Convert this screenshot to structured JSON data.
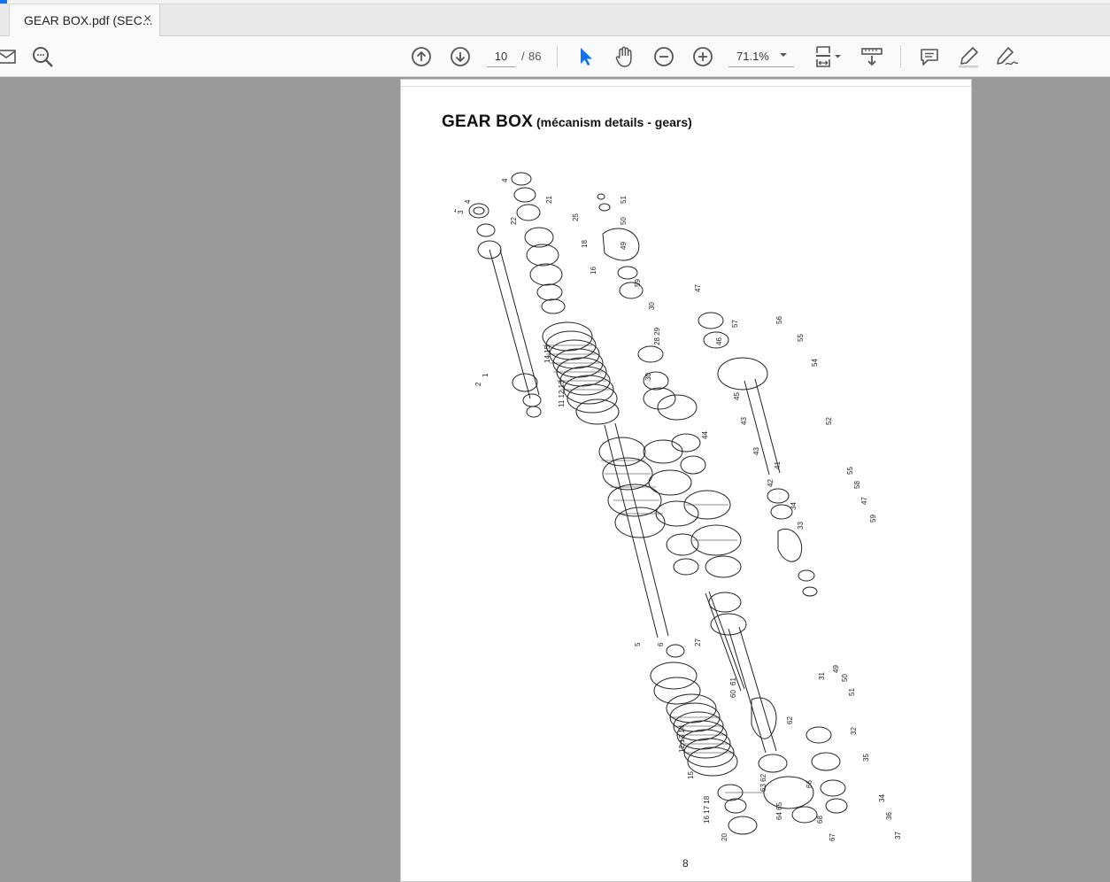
{
  "tab": {
    "title": "GEAR BOX.pdf (SEC...",
    "close_glyph": "×"
  },
  "toolbar": {
    "left_icons": [
      "mail-icon",
      "search-icon"
    ],
    "nav": {
      "prev_icon": "arrow-up-circle-icon",
      "next_icon": "arrow-down-circle-icon"
    },
    "page_current": "10",
    "page_separator": "/",
    "page_total": "86",
    "tools": [
      "select-cursor-icon",
      "hand-icon",
      "zoom-out-icon",
      "zoom-in-icon"
    ],
    "zoom": "71.1%",
    "right_icons": [
      "page-fit-icon",
      "scroll-mode-icon",
      "comment-icon",
      "highlight-pen-icon",
      "sign-icon"
    ]
  },
  "document": {
    "title_main": "GEAR BOX",
    "title_sub": "(mécanism details - gears)",
    "page_number": "8",
    "callouts": [
      "1",
      "2",
      "3",
      "4",
      "5",
      "6",
      "7",
      "8",
      "9",
      "10",
      "11",
      "12",
      "13",
      "14",
      "15",
      "16",
      "17",
      "18",
      "19",
      "20",
      "21",
      "22",
      "23",
      "24",
      "25",
      "26",
      "27",
      "28",
      "29",
      "30",
      "31",
      "32",
      "33",
      "34",
      "35",
      "36",
      "37",
      "38",
      "39",
      "40",
      "41",
      "42",
      "43",
      "44",
      "45",
      "46",
      "47",
      "49",
      "50",
      "51",
      "52",
      "54",
      "55",
      "56",
      "57",
      "58",
      "59",
      "60",
      "61",
      "62",
      "63",
      "64",
      "65",
      "66",
      "67",
      "68"
    ]
  },
  "colors": {
    "accent": "#1473e6",
    "toolbar_bg": "#fafafa",
    "canvas_bg": "#9a9a9a"
  }
}
